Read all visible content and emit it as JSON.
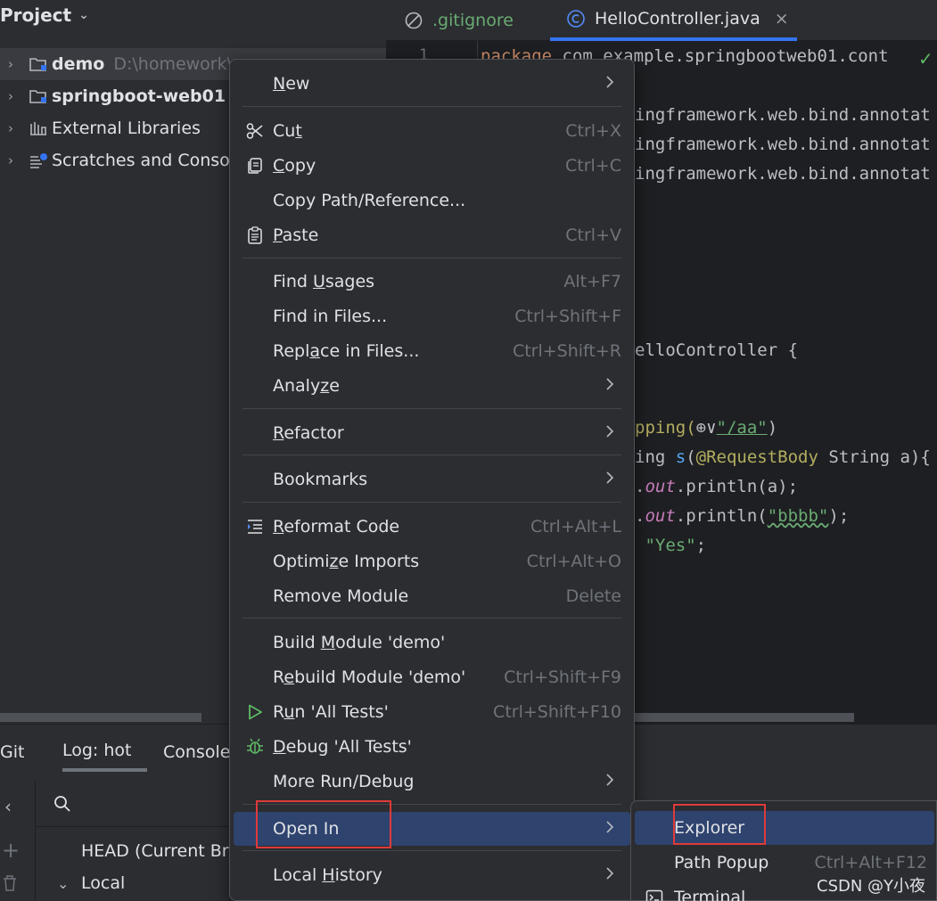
{
  "project_pane": {
    "title": "Project",
    "tree": [
      {
        "label": "demo",
        "hint": "D:\\homework\\",
        "selected": true,
        "bold": true,
        "icon": "module-folder-icon"
      },
      {
        "label": "springboot-web01",
        "hint": "",
        "selected": false,
        "bold": true,
        "icon": "module-folder-icon"
      },
      {
        "label": "External Libraries",
        "hint": "",
        "selected": false,
        "bold": false,
        "icon": "library-icon"
      },
      {
        "label": "Scratches and Conso",
        "hint": "",
        "selected": false,
        "bold": false,
        "icon": "scratches-icon"
      }
    ]
  },
  "editor": {
    "tabs": [
      {
        "label": ".gitignore",
        "icon": "ignore-file-icon",
        "active": false,
        "color": "#6aab73"
      },
      {
        "label": "HelloController.java",
        "icon": "class-icon",
        "active": true,
        "close": "×"
      }
    ],
    "line_number": "1",
    "lines": {
      "l1_kw": "package",
      "l1_rest": " com.example.springbootweb01.cont",
      "l2": "ingframework.web.bind.annotat",
      "l3": "ingframework.web.bind.annotat",
      "l4": "ingframework.web.bind.annotat",
      "l5": "elloController {",
      "l6_ann": "pping(",
      "l6_str": "\"/aa\"",
      "l6_end": ")",
      "l7_a": "ing ",
      "l7_method": "s",
      "l7_b": "(",
      "l7_ann": "@RequestBody",
      "l7_c": " String a){",
      "l8_out": "out",
      "l8_rest": ".println(a);",
      "l9_out": "out",
      "l9_b": ".println(",
      "l9_str": "\"bbbb\"",
      "l9_end": ");",
      "l10_str": "\"Yes\"",
      "l10_end": ";"
    }
  },
  "git_panel": {
    "tabs": [
      "Git",
      "Log: hot",
      "Console"
    ],
    "items": [
      "HEAD (Current Bra",
      "Local"
    ]
  },
  "context_menu": {
    "items": [
      {
        "id": "new",
        "pre": "",
        "u": "N",
        "post": "ew",
        "shortcut": "",
        "submenu": true
      },
      {
        "id": "cut",
        "pre": "Cu",
        "u": "t",
        "post": "",
        "shortcut": "Ctrl+X",
        "icon": "scissors-icon"
      },
      {
        "id": "copy",
        "pre": "",
        "u": "C",
        "post": "opy",
        "shortcut": "Ctrl+C",
        "icon": "copy-icon"
      },
      {
        "id": "copy-path",
        "pre": "Copy Path/Reference...",
        "u": "",
        "post": "",
        "shortcut": ""
      },
      {
        "id": "paste",
        "pre": "",
        "u": "P",
        "post": "aste",
        "shortcut": "Ctrl+V",
        "icon": "clipboard-icon"
      },
      {
        "id": "find-usages",
        "pre": "Find ",
        "u": "U",
        "post": "sages",
        "shortcut": "Alt+F7"
      },
      {
        "id": "find-in-files",
        "pre": "Find in Files...",
        "u": "",
        "post": "",
        "shortcut": "Ctrl+Shift+F"
      },
      {
        "id": "replace-in-files",
        "pre": "Repl",
        "u": "a",
        "post": "ce in Files...",
        "shortcut": "Ctrl+Shift+R"
      },
      {
        "id": "analyze",
        "pre": "Analy",
        "u": "z",
        "post": "e",
        "shortcut": "",
        "submenu": true
      },
      {
        "id": "refactor",
        "pre": "",
        "u": "R",
        "post": "efactor",
        "shortcut": "",
        "submenu": true
      },
      {
        "id": "bookmarks",
        "pre": "Bookmarks",
        "u": "",
        "post": "",
        "shortcut": "",
        "submenu": true
      },
      {
        "id": "reformat-code",
        "pre": "",
        "u": "R",
        "post": "eformat Code",
        "shortcut": "Ctrl+Alt+L",
        "icon": "reformat-icon"
      },
      {
        "id": "optimize-imports",
        "pre": "Optimi",
        "u": "z",
        "post": "e Imports",
        "shortcut": "Ctrl+Alt+O"
      },
      {
        "id": "remove-module",
        "pre": "Remove Module",
        "u": "",
        "post": "",
        "shortcut": "Delete"
      },
      {
        "id": "build-module",
        "pre": "Build ",
        "u": "M",
        "post": "odule 'demo'",
        "shortcut": ""
      },
      {
        "id": "rebuild-module",
        "pre": "R",
        "u": "e",
        "post": "build Module 'demo'",
        "shortcut": "Ctrl+Shift+F9"
      },
      {
        "id": "run-all-tests",
        "pre": "R",
        "u": "u",
        "post": "n 'All Tests'",
        "shortcut": "Ctrl+Shift+F10",
        "icon": "run-icon"
      },
      {
        "id": "debug-all-tests",
        "pre": "",
        "u": "D",
        "post": "ebug 'All Tests'",
        "shortcut": "",
        "icon": "debug-icon"
      },
      {
        "id": "more-run-debug",
        "pre": "More Run/Debug",
        "u": "",
        "post": "",
        "shortcut": "",
        "submenu": true
      },
      {
        "id": "open-in",
        "pre": "Open In",
        "u": "",
        "post": "",
        "shortcut": "",
        "submenu": true,
        "highlighted": true
      },
      {
        "id": "local-history",
        "pre": "Local ",
        "u": "H",
        "post": "istory",
        "shortcut": "",
        "submenu": true
      }
    ]
  },
  "open_in_submenu": {
    "items": [
      {
        "id": "explorer",
        "label": "Explorer",
        "shortcut": "",
        "highlighted": true
      },
      {
        "id": "path-popup",
        "label": "Path Popup",
        "shortcut": "Ctrl+Alt+F12"
      },
      {
        "id": "terminal",
        "label": "Terminal",
        "shortcut": "",
        "icon": "terminal-icon"
      }
    ]
  },
  "watermark": "CSDN @Y小夜",
  "colors": {
    "highlight": "#2e436e",
    "annotation_box": "#e03a3a",
    "accent": "#3574f0"
  }
}
